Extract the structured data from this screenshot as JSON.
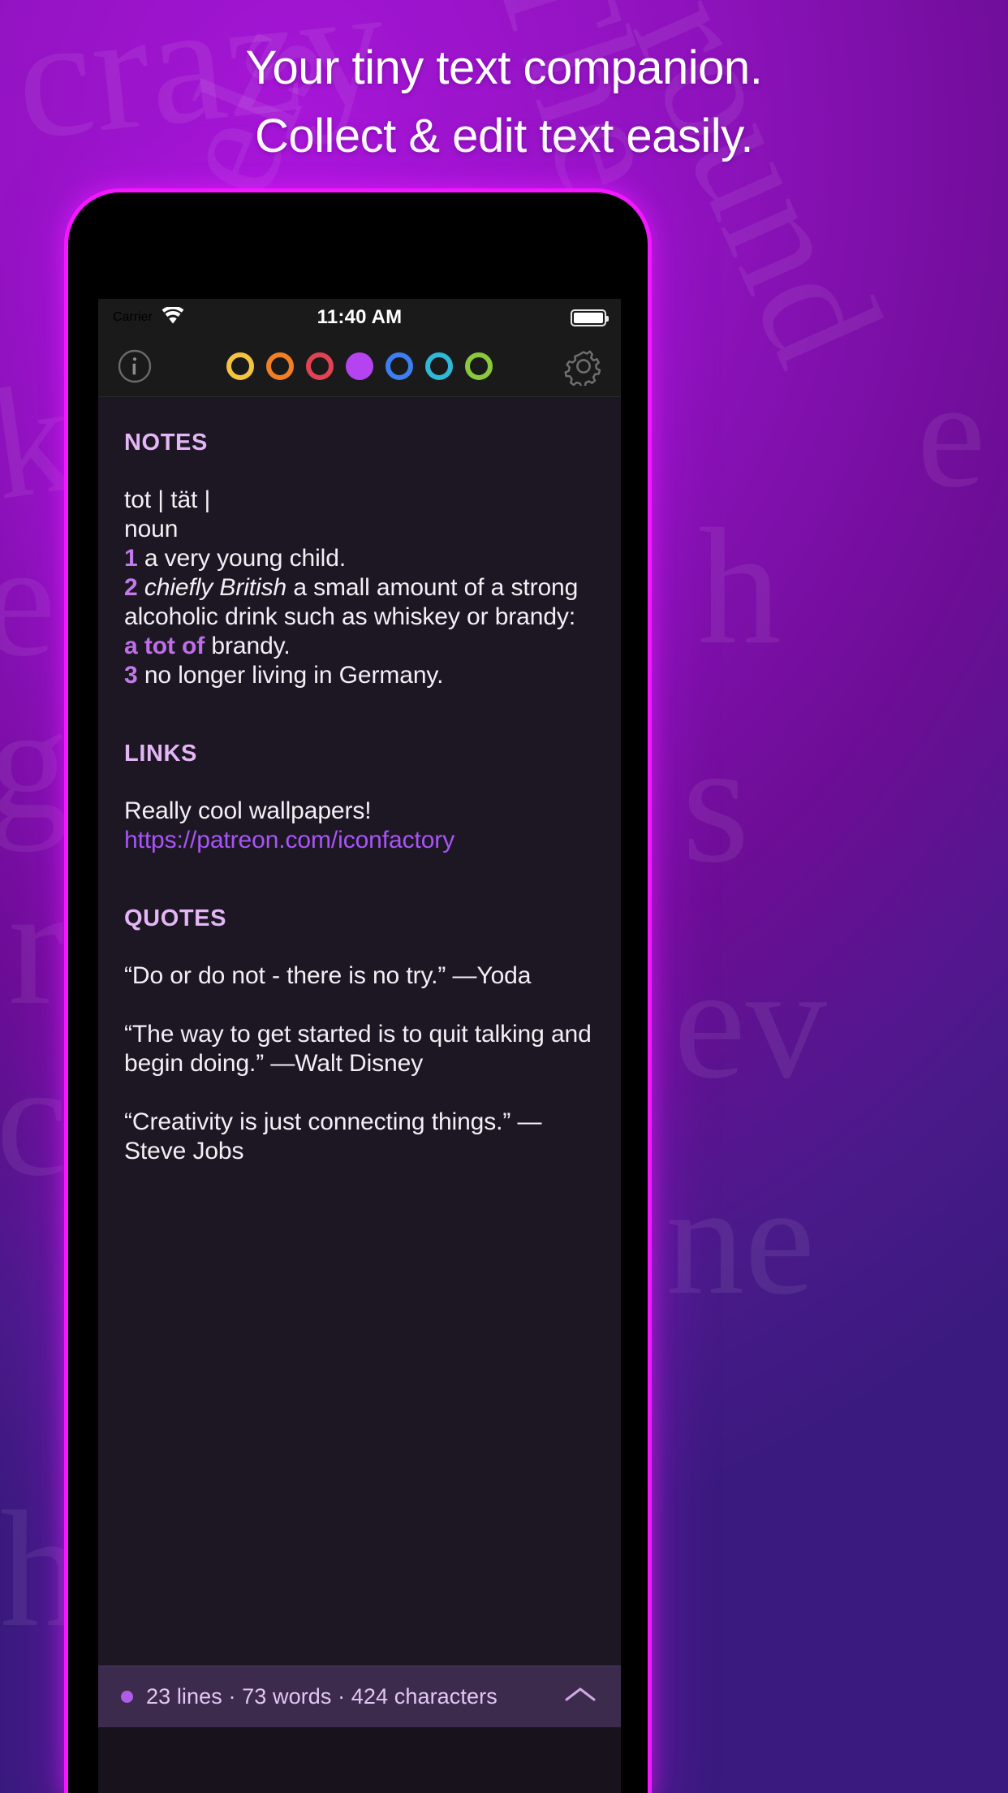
{
  "promo": {
    "headline_line1": "Your tiny text companion.",
    "headline_line2": "Collect & edit text easily.",
    "background_words": [
      "crazy",
      "The",
      "rebels",
      "round",
      "ke",
      "e",
      "h",
      "gs",
      "r n",
      "ct",
      "e",
      "s",
      "ev",
      "ne",
      "he"
    ]
  },
  "statusbar": {
    "carrier": "Carrier",
    "wifi_icon": "wifi-icon",
    "time": "11:40 AM",
    "battery_icon": "battery-full-icon"
  },
  "toolbar": {
    "info_icon": "info-circle-icon",
    "settings_icon": "gear-icon",
    "swatches": [
      {
        "name": "swatch-yellow",
        "color": "#f5c342",
        "selected": false
      },
      {
        "name": "swatch-orange",
        "color": "#f07f25",
        "selected": false
      },
      {
        "name": "swatch-red",
        "color": "#e24354",
        "selected": false
      },
      {
        "name": "swatch-purple",
        "color": "#b544f0",
        "selected": true
      },
      {
        "name": "swatch-blue",
        "color": "#3d7ef0",
        "selected": false
      },
      {
        "name": "swatch-cyan",
        "color": "#30b8d8",
        "selected": false
      },
      {
        "name": "swatch-green",
        "color": "#8bc83c",
        "selected": false
      }
    ]
  },
  "notes": {
    "heading": "NOTES",
    "line_headword": "tot | tät |",
    "line_pos": "noun",
    "def1_num": "1",
    "def1_text": " a very young child.",
    "def2_num": "2",
    "def2_italic": "chiefly British",
    "def2_text_a": " a small amount of a strong alcoholic drink such as whiskey or brandy: ",
    "def2_accent": "a tot of",
    "def2_text_b": " brandy.",
    "def3_num": "3",
    "def3_text": " no longer living in Germany."
  },
  "links": {
    "heading": "LINKS",
    "label": "Really cool wallpapers!",
    "url": "https://patreon.com/iconfactory"
  },
  "quotes": {
    "heading": "QUOTES",
    "items": [
      "“Do or do not - there is no try.” —Yoda",
      "“The way to get started is to quit talking and begin doing.” —Walt Disney",
      "“Creativity is just connecting things.” —Steve Jobs"
    ]
  },
  "footer": {
    "counts": "23 lines · 73 words · 424 characters",
    "collapse_icon": "chevron-up-icon"
  },
  "colors": {
    "brand_magenta": "#f318ff",
    "accent_purple": "#b544f0",
    "section_heading": "#e3b6f5",
    "link": "#a855f7",
    "screen_bg": "#1d1724",
    "footer_bg": "#3d2b4e"
  }
}
